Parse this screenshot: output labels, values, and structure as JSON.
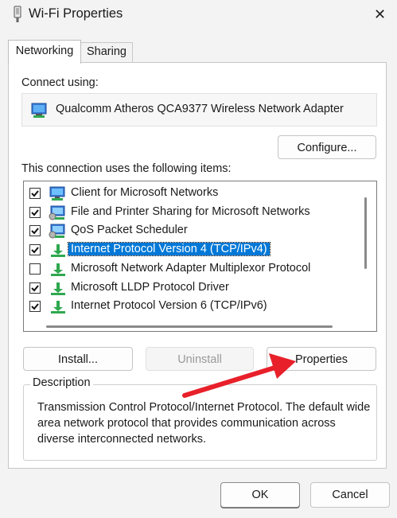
{
  "window": {
    "title": "Wi-Fi Properties",
    "close_glyph": "✕"
  },
  "tabs": [
    {
      "label": "Networking",
      "active": true
    },
    {
      "label": "Sharing",
      "active": false
    }
  ],
  "connect_using": {
    "label": "Connect using:",
    "adapter": "Qualcomm Atheros QCA9377 Wireless Network Adapter",
    "adapter_icon": "network-adapter-icon"
  },
  "configure_label": "Configure...",
  "items_label": "This connection uses the following items:",
  "items": [
    {
      "label": "Client for Microsoft Networks",
      "checked": true,
      "icon": "network-client-icon",
      "selected": false
    },
    {
      "label": "File and Printer Sharing for Microsoft Networks",
      "checked": true,
      "icon": "network-service-icon",
      "selected": false
    },
    {
      "label": "QoS Packet Scheduler",
      "checked": true,
      "icon": "network-service-icon",
      "selected": false
    },
    {
      "label": "Internet Protocol Version 4 (TCP/IPv4)",
      "checked": true,
      "icon": "protocol-icon",
      "selected": true
    },
    {
      "label": "Microsoft Network Adapter Multiplexor Protocol",
      "checked": false,
      "icon": "protocol-icon",
      "selected": false
    },
    {
      "label": "Microsoft LLDP Protocol Driver",
      "checked": true,
      "icon": "protocol-icon",
      "selected": false
    },
    {
      "label": "Internet Protocol Version 6 (TCP/IPv6)",
      "checked": true,
      "icon": "protocol-icon",
      "selected": false
    }
  ],
  "buttons": {
    "install": "Install...",
    "uninstall": "Uninstall",
    "properties": "Properties",
    "ok": "OK",
    "cancel": "Cancel"
  },
  "description": {
    "legend": "Description",
    "text": "Transmission Control Protocol/Internet Protocol. The default wide area network protocol that provides communication across diverse interconnected networks."
  },
  "colors": {
    "selection": "#0078d7",
    "annotation_arrow": "#e8202a",
    "window_bg": "#f3f3f3"
  }
}
